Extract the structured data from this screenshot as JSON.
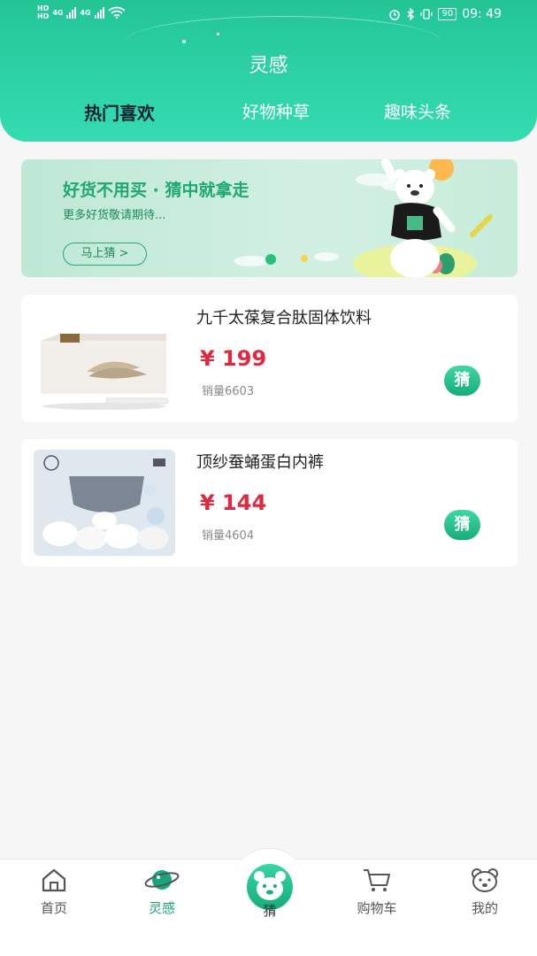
{
  "status_bar": {
    "hd1": "HD",
    "hd2": "HD",
    "net1": "4G",
    "net2": "4G",
    "battery": "90",
    "time": "09: 49"
  },
  "header": {
    "title": "灵感",
    "tabs": [
      {
        "label": "热门喜欢",
        "active": true
      },
      {
        "label": "好物种草",
        "active": false
      },
      {
        "label": "趣味头条",
        "active": false
      }
    ]
  },
  "banner": {
    "title": "好货不用买 · 猜中就拿走",
    "subtitle": "更多好货敬请期待...",
    "button": "马上猜 >"
  },
  "products": [
    {
      "name": "九千太葆复合肽固体饮料",
      "price": "¥ 199",
      "sales": "销量6603",
      "action": "猜"
    },
    {
      "name": "顶纱蚕蛹蛋白内裤",
      "price": "¥ 144",
      "sales": "销量4604",
      "action": "猜"
    }
  ],
  "bottom_nav": {
    "items": [
      {
        "label": "首页",
        "icon": "home-icon"
      },
      {
        "label": "灵感",
        "icon": "planet-icon",
        "active": true
      },
      {
        "label": "猜",
        "icon": "bear-face-icon"
      },
      {
        "label": "购物车",
        "icon": "cart-icon"
      },
      {
        "label": "我的",
        "icon": "bear-head-icon"
      }
    ]
  },
  "colors": {
    "accent": "#23c596",
    "price": "#e02940",
    "banner_text": "#1fa870"
  }
}
